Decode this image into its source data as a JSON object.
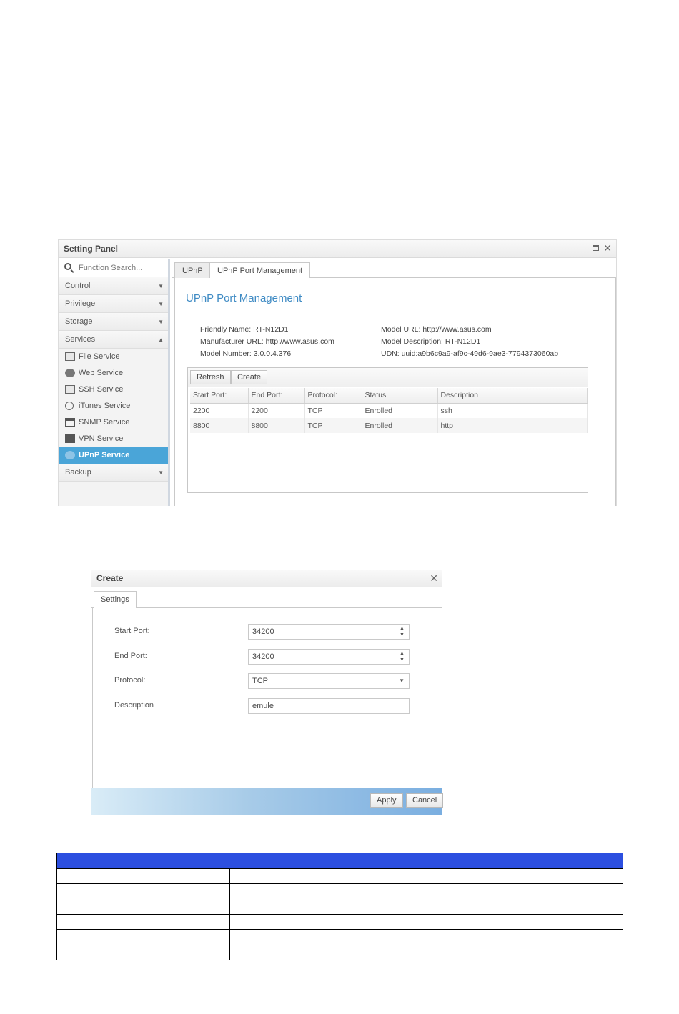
{
  "setting_panel": {
    "title": "Setting Panel",
    "search": {
      "placeholder": "Function Search..."
    },
    "sidebar": {
      "categories_top": [
        {
          "label": "Control",
          "arrow": "▼"
        },
        {
          "label": "Privilege",
          "arrow": "▼"
        },
        {
          "label": "Storage",
          "arrow": "▼"
        },
        {
          "label": "Services",
          "arrow": "▲"
        }
      ],
      "services": [
        {
          "label": "File Service",
          "icon": "file-service-icon"
        },
        {
          "label": "Web Service",
          "icon": "web-service-icon"
        },
        {
          "label": "SSH Service",
          "icon": "ssh-service-icon"
        },
        {
          "label": "iTunes Service",
          "icon": "itunes-service-icon"
        },
        {
          "label": "SNMP Service",
          "icon": "snmp-service-icon"
        },
        {
          "label": "VPN Service",
          "icon": "vpn-service-icon"
        },
        {
          "label": "UPnP Service",
          "icon": "upnp-service-icon",
          "active": true
        }
      ],
      "categories_bottom": [
        {
          "label": "Backup",
          "arrow": "▼"
        }
      ]
    },
    "tabs": [
      {
        "label": "UPnP"
      },
      {
        "label": "UPnP Port Management",
        "active": true
      }
    ],
    "page_title": "UPnP Port Management",
    "info_left": [
      "Friendly Name: RT-N12D1",
      "Manufacturer URL: http://www.asus.com",
      "Model Number: 3.0.0.4.376"
    ],
    "info_right": [
      "Model URL: http://www.asus.com",
      "Model Description: RT-N12D1",
      "UDN: uuid:a9b6c9a9-af9c-49d6-9ae3-7794373060ab"
    ],
    "toolbar": {
      "refresh": "Refresh",
      "create": "Create"
    },
    "table": {
      "columns": [
        "Start Port:",
        "End Port:",
        "Protocol:",
        "Status",
        "Description"
      ],
      "rows": [
        [
          "2200",
          "2200",
          "TCP",
          "Enrolled",
          "ssh"
        ],
        [
          "8800",
          "8800",
          "TCP",
          "Enrolled",
          "http"
        ]
      ]
    }
  },
  "create_dialog": {
    "title": "Create",
    "tab": "Settings",
    "fields": {
      "start_port": {
        "label": "Start Port:",
        "value": "34200"
      },
      "end_port": {
        "label": "End Port:",
        "value": "34200"
      },
      "protocol": {
        "label": "Protocol:",
        "value": "TCP"
      },
      "description": {
        "label": "Description",
        "value": "emule"
      }
    },
    "buttons": {
      "apply": "Apply",
      "cancel": "Cancel"
    }
  },
  "colors": {
    "accent": "#3f8bc4",
    "active_item": "#4aa5d8",
    "table_header": "#2c4fe0"
  }
}
